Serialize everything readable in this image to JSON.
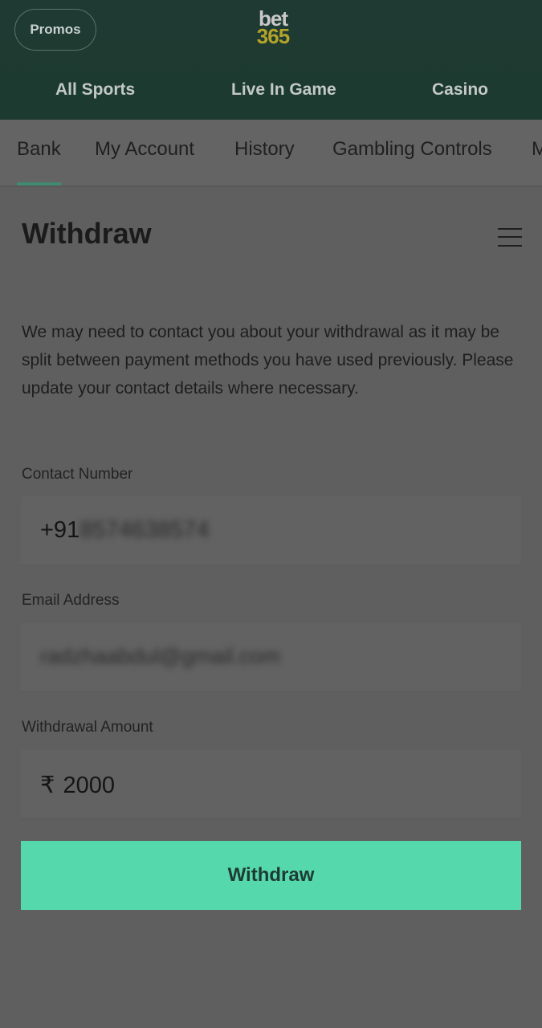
{
  "header": {
    "promos_label": "Promos",
    "logo_line1": "bet",
    "logo_line2": "365",
    "nav": [
      "All Sports",
      "Live In Game",
      "Casino"
    ]
  },
  "subnav": {
    "tabs": [
      "Bank",
      "My Account",
      "History",
      "Gambling Controls",
      "M"
    ],
    "active": "Bank"
  },
  "page": {
    "title": "Withdraw",
    "info": "We may need to contact you about your withdrawal as it may be split between payment methods you have used previously. Please update your contact details where necessary."
  },
  "form": {
    "contact_label": "Contact Number",
    "contact_prefix": "+91",
    "contact_rest": "8574638574",
    "email_label": "Email Address",
    "email_value": "radzhaabdul@gmail.com",
    "amount_label": "Withdrawal Amount",
    "currency_symbol": "₹",
    "amount_value": "2000",
    "submit_label": "Withdraw"
  },
  "colors": {
    "header_bg": "#1f3a32",
    "accent": "#56d8ad",
    "logo_gold": "#b3a32b"
  }
}
